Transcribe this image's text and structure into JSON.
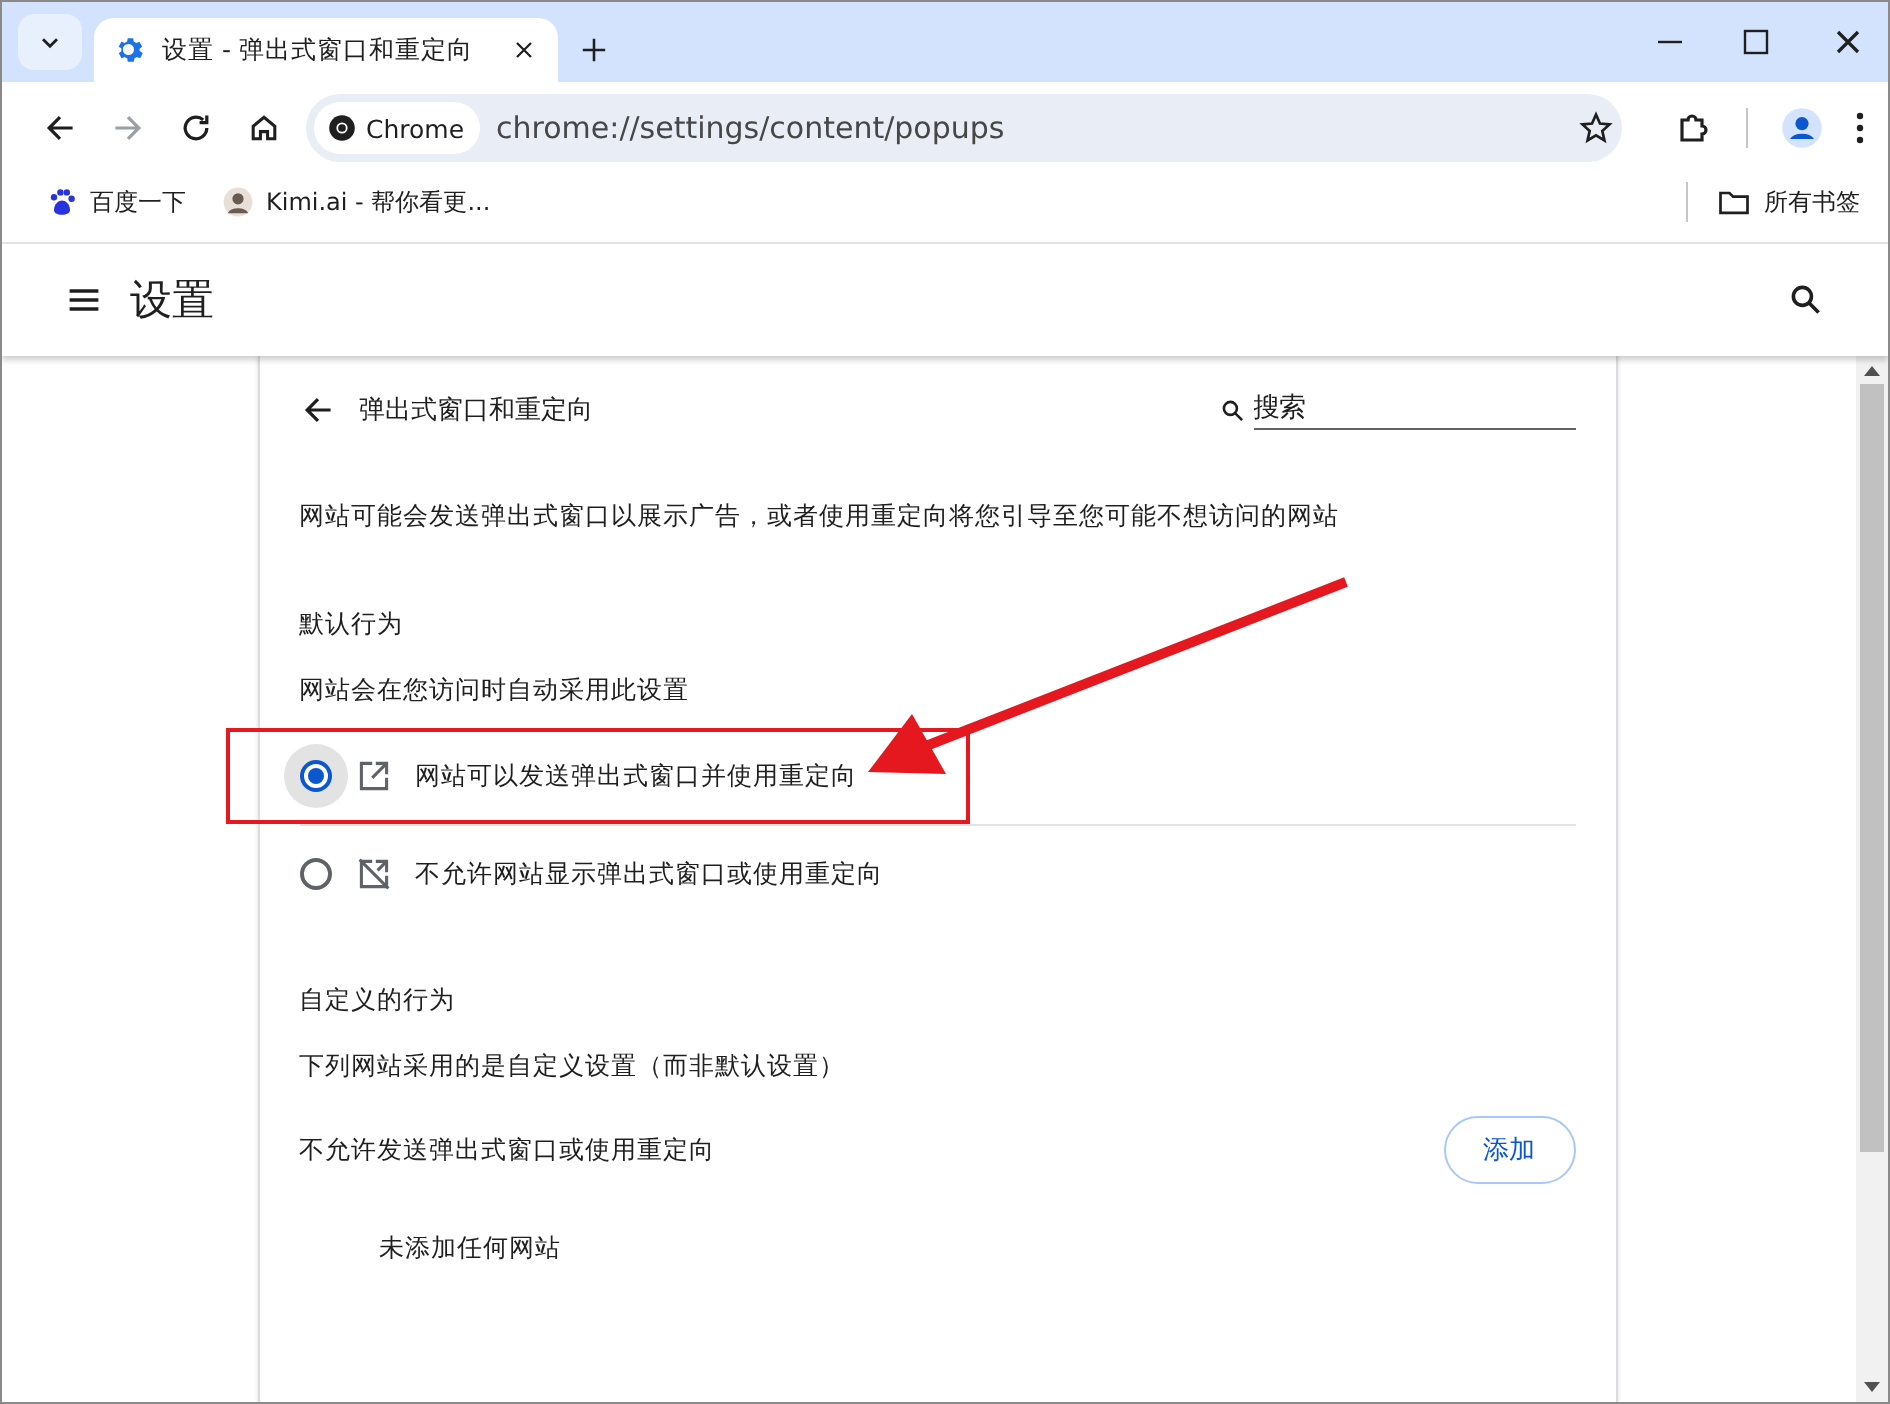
{
  "tabs": [
    {
      "title": "设置 - 弹出式窗口和重定向",
      "selected": true
    }
  ],
  "toolbar": {
    "chip": "Chrome",
    "url": "chrome://settings/content/popups"
  },
  "bookmarks": [
    {
      "label": "百度一下",
      "kind": "paw"
    },
    {
      "label": "Kimi.ai - 帮你看更...",
      "kind": "avatar"
    }
  ],
  "all_bookmarks": "所有书签",
  "settings_title": "设置",
  "page": {
    "title": "弹出式窗口和重定向",
    "search_placeholder": "搜索",
    "description": "网站可能会发送弹出式窗口以展示广告，或者使用重定向将您引导至您可能不想访问的网站",
    "default_heading": "默认行为",
    "default_sub": "网站会在您访问时自动采用此设置",
    "options": [
      {
        "label": "网站可以发送弹出式窗口并使用重定向",
        "kind": "allow",
        "selected": true
      },
      {
        "label": "不允许网站显示弹出式窗口或使用重定向",
        "kind": "block",
        "selected": false
      }
    ],
    "custom_heading": "自定义的行为",
    "custom_sub": "下列网站采用的是自定义设置（而非默认设置）",
    "sections": [
      {
        "label": "不允许发送弹出式窗口或使用重定向",
        "button": "添加",
        "empty": "未添加任何网站"
      }
    ]
  }
}
